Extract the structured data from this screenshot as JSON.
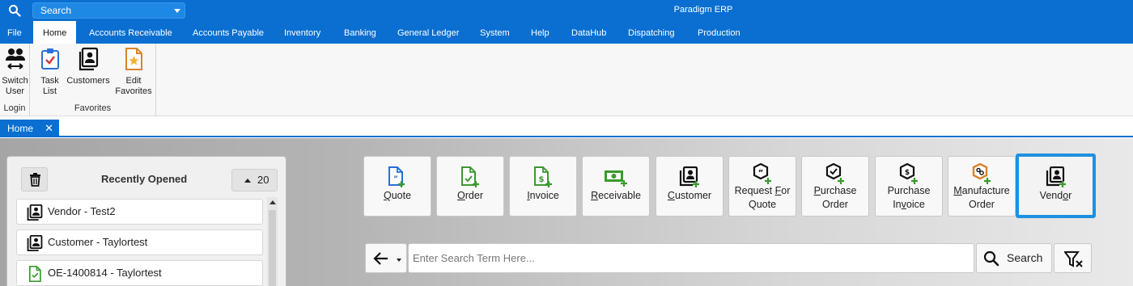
{
  "titlebar": {
    "search_label": "Search",
    "app_title": "Paradigm ERP"
  },
  "menu": {
    "items": [
      "File",
      "Home",
      "Accounts Receivable",
      "Accounts Payable",
      "Inventory",
      "Banking",
      "General Ledger",
      "System",
      "Help",
      "DataHub",
      "Dispatching",
      "Production"
    ],
    "active": "Home"
  },
  "ribbon": {
    "login_group": {
      "label": "Login",
      "switch_user": [
        "Switch",
        "User"
      ]
    },
    "favorites_group": {
      "label": "Favorites",
      "task_list": [
        "Task",
        "List"
      ],
      "customers": "Customers",
      "edit_favorites": [
        "Edit",
        "Favorites"
      ]
    }
  },
  "tabs": {
    "home": "Home",
    "close_glyph": "✕"
  },
  "recent": {
    "title": "Recently Opened",
    "count": "20",
    "items": [
      {
        "label": "Vendor - Test2",
        "icon": "vendor-icon"
      },
      {
        "label": "Customer - Taylortest",
        "icon": "customer-icon"
      },
      {
        "label": "OE-1400814 - Taylortest",
        "icon": "order-document-icon"
      }
    ]
  },
  "tiles": {
    "quote": {
      "pre": "",
      "ul": "Q",
      "post": "uote"
    },
    "order": {
      "pre": "",
      "ul": "O",
      "post": "rder"
    },
    "invoice": {
      "pre": "",
      "ul": "I",
      "post": "nvoice"
    },
    "receivable": {
      "pre": "",
      "ul": "R",
      "post": "eceivable"
    },
    "customer": {
      "pre": "",
      "ul": "C",
      "post": "ustomer"
    },
    "rfq": {
      "line1_pre": "Request ",
      "line1_ul": "F",
      "line1_post": "or",
      "line2": "Quote"
    },
    "purchase_order": {
      "line1_pre": "",
      "line1_ul": "P",
      "line1_post": "urchase",
      "line2": "Order"
    },
    "purchase_invoice": {
      "line1": "Purchase",
      "line2_pre": "In",
      "line2_ul": "v",
      "line2_post": "oice"
    },
    "manufacture_order": {
      "line1_pre": "",
      "line1_ul": "M",
      "line1_post": "anufacture",
      "line2": "Order"
    },
    "vendor": {
      "pre": "Vend",
      "ul": "o",
      "post": "r"
    }
  },
  "search": {
    "placeholder": "Enter Search Term Here...",
    "button_label": "Search"
  },
  "colors": {
    "accent": "#0a6fd1",
    "selected_tile_border": "#1e90e0",
    "icon_blue": "#2a6fd6",
    "icon_green": "#3a9a2e",
    "icon_orange": "#d9842a"
  }
}
